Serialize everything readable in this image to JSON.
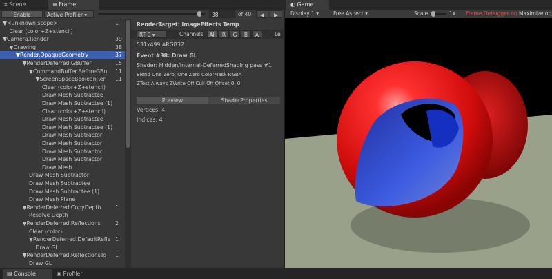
{
  "tabs": {
    "scene": "Scene",
    "frame_debug": "Frame Debug",
    "game": "Game"
  },
  "fd_toolbar": {
    "enable": "Enable",
    "profiler": "Active Profiler",
    "event_index": "38",
    "of_total": "of 40",
    "event_fraction": 0.95
  },
  "tree": [
    {
      "label": "▼<unknown scope>",
      "count": "1",
      "indent": 0
    },
    {
      "label": "Clear (color+Z+stencil)",
      "count": "",
      "indent": 1
    },
    {
      "label": "▼Camera.Render",
      "count": "39",
      "indent": 0
    },
    {
      "label": "▼Drawing",
      "count": "38",
      "indent": 1
    },
    {
      "label": "▼Render.OpaqueGeometry",
      "count": "37",
      "indent": 2,
      "selected": true
    },
    {
      "label": "▼RenderDeferred.GBuffer",
      "count": "15",
      "indent": 3
    },
    {
      "label": "▼CommandBuffer.BeforeGBu",
      "count": "11",
      "indent": 4
    },
    {
      "label": "▼ScreenSpaceBooleanRer",
      "count": "11",
      "indent": 5
    },
    {
      "label": "Clear (color+Z+stencil)",
      "count": "",
      "indent": 6
    },
    {
      "label": "Draw Mesh Subtractee",
      "count": "",
      "indent": 6
    },
    {
      "label": "Draw Mesh Subtractee (1)",
      "count": "",
      "indent": 6
    },
    {
      "label": "Clear (color+Z+stencil)",
      "count": "",
      "indent": 6
    },
    {
      "label": "Draw Mesh Subtractee",
      "count": "",
      "indent": 6
    },
    {
      "label": "Draw Mesh Subtractee (1)",
      "count": "",
      "indent": 6
    },
    {
      "label": "Draw Mesh Subtractor",
      "count": "",
      "indent": 6
    },
    {
      "label": "Draw Mesh Subtractor",
      "count": "",
      "indent": 6
    },
    {
      "label": "Draw Mesh Subtractor",
      "count": "",
      "indent": 6
    },
    {
      "label": "Draw Mesh Subtractor",
      "count": "",
      "indent": 6
    },
    {
      "label": "Draw Mesh",
      "count": "",
      "indent": 6
    },
    {
      "label": "Draw Mesh Subtractor",
      "count": "",
      "indent": 4
    },
    {
      "label": "Draw Mesh Subtractee",
      "count": "",
      "indent": 4
    },
    {
      "label": "Draw Mesh Subtractee (1)",
      "count": "",
      "indent": 4
    },
    {
      "label": "Draw Mesh Plane",
      "count": "",
      "indent": 4
    },
    {
      "label": "▼RenderDeferred.CopyDepth",
      "count": "1",
      "indent": 3
    },
    {
      "label": "Resolve Depth",
      "count": "",
      "indent": 4
    },
    {
      "label": "▼RenderDeferred.Reflections",
      "count": "2",
      "indent": 3
    },
    {
      "label": "Clear (color)",
      "count": "",
      "indent": 4
    },
    {
      "label": "▼RenderDeferred.DefaultRefle",
      "count": "1",
      "indent": 4
    },
    {
      "label": "Draw GL",
      "count": "",
      "indent": 5
    },
    {
      "label": "▼RenderDeferred.ReflectionsTo",
      "count": "1",
      "indent": 3
    },
    {
      "label": "Draw GL",
      "count": "",
      "indent": 4
    }
  ],
  "details": {
    "render_target": "RenderTarget: ImageEffects Temp",
    "rt_select": "RT 0",
    "channels_label": "Channels",
    "channels": [
      "All",
      "R",
      "G",
      "B",
      "A"
    ],
    "levels": "Le",
    "size": "531x499 ARGB32",
    "event": "Event #38: Draw GL",
    "shader": "Shader: Hidden/Internal-DeferredShading pass #1",
    "blend": "Blend One Zero, One Zero ColorMask RGBA",
    "ztest": "ZTest Always ZWrite Off Cull Off Offset 0, 0",
    "preview_tab": "Preview",
    "shaderprops_tab": "ShaderProperties",
    "vertices": "Vertices: 4",
    "indices": "Indices: 4"
  },
  "game_toolbar": {
    "display": "Display 1",
    "aspect": "Free Aspect",
    "scale_label": "Scale",
    "scale_value": "1x",
    "fd_status": "Frame Debugger on",
    "maximize": "Maximize on"
  },
  "bottom": {
    "console": "Console",
    "profiler": "Profiler"
  },
  "colors": {
    "selection": "#3e5fae",
    "fd_status": "#e05050",
    "sphere": "#e01010"
  }
}
